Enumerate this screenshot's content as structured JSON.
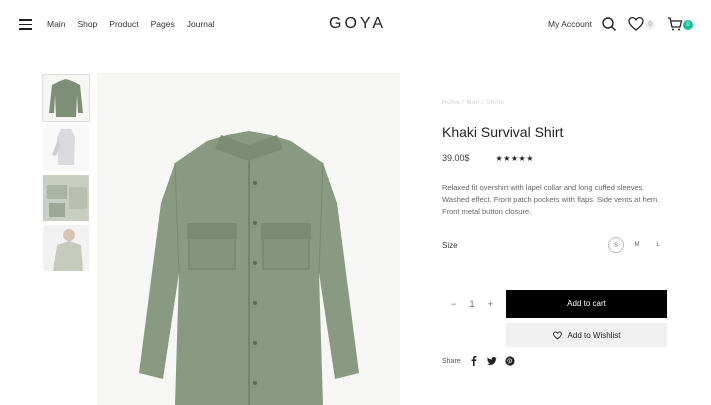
{
  "header": {
    "logo": "GOYA",
    "nav": [
      "Main",
      "Shop",
      "Product",
      "Pages",
      "Journal"
    ],
    "account": "My Account",
    "wishlist_count": "0",
    "cart_count": "0"
  },
  "product": {
    "breadcrumb": "Home / Men / Shirts",
    "title": "Khaki Survival Shirt",
    "price": "39.00$",
    "rating": "★★★★★",
    "description": "Relaxed fit overshirt with lapel collar and long cuffed sleeves. Washed effect. Front patch pockets with flaps. Side vents at hem. Front metal button closure.",
    "size_label": "Size",
    "sizes": [
      "S",
      "M",
      "L"
    ],
    "selected_size": "S",
    "quantity": "1",
    "qty_minus": "−",
    "qty_plus": "+",
    "add_to_cart": "Add to cart",
    "add_to_wishlist": "Add to Wishlist",
    "share_label": "Share"
  },
  "colors": {
    "accent": "#1abc9c",
    "primary_button": "#000000",
    "shirt": "#8a9a82"
  },
  "icons": [
    "menu-icon",
    "search-icon",
    "heart-icon",
    "cart-icon",
    "facebook-icon",
    "twitter-icon",
    "pinterest-icon"
  ]
}
